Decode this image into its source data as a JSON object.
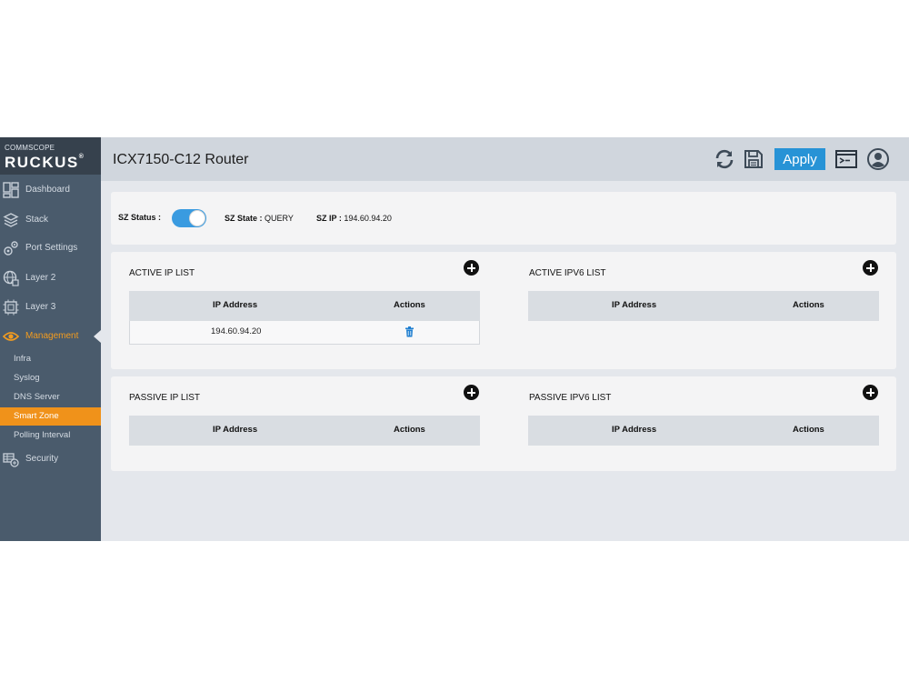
{
  "brand": {
    "company": "COMMSCOPE",
    "product": "RUCKUS"
  },
  "sidebar": {
    "items": [
      {
        "label": "Dashboard",
        "icon": "dashboard-icon"
      },
      {
        "label": "Stack",
        "icon": "stack-icon"
      },
      {
        "label": "Port Settings",
        "icon": "port-settings-icon"
      },
      {
        "label": "Layer 2",
        "icon": "layer2-icon"
      },
      {
        "label": "Layer 3",
        "icon": "layer3-icon"
      },
      {
        "label": "Management",
        "icon": "eye-icon"
      }
    ],
    "management_sub": [
      "Infra",
      "Syslog",
      "DNS Server",
      "Smart Zone",
      "Polling Interval"
    ],
    "security": {
      "label": "Security",
      "icon": "security-icon"
    },
    "active_item": "Management",
    "active_sub": "Smart Zone"
  },
  "header": {
    "title": "ICX7150-C12 Router",
    "apply_label": "Apply"
  },
  "status": {
    "sz_status_label": "SZ Status :",
    "sz_status_on": true,
    "sz_state_label": "SZ State :",
    "sz_state_value": "QUERY",
    "sz_ip_label": "SZ IP :",
    "sz_ip_value": "194.60.94.20"
  },
  "active_ip": {
    "title": "ACTIVE IP LIST",
    "col_ip": "IP Address",
    "col_actions": "Actions",
    "rows": [
      {
        "ip": "194.60.94.20"
      }
    ]
  },
  "active_ipv6": {
    "title": "ACTIVE IPV6 LIST",
    "col_ip": "IP Address",
    "col_actions": "Actions",
    "rows": []
  },
  "passive_ip": {
    "title": "PASSIVE IP LIST",
    "col_ip": "IP Address",
    "col_actions": "Actions",
    "rows": []
  },
  "passive_ipv6": {
    "title": "PASSIVE IPV6 LIST",
    "col_ip": "IP Address",
    "col_actions": "Actions",
    "rows": []
  },
  "colors": {
    "sidebar": "#4a5b6c",
    "accent": "#f0921a",
    "apply": "#2793d6",
    "toggle": "#3a9be0",
    "delete": "#1f7fd1"
  }
}
